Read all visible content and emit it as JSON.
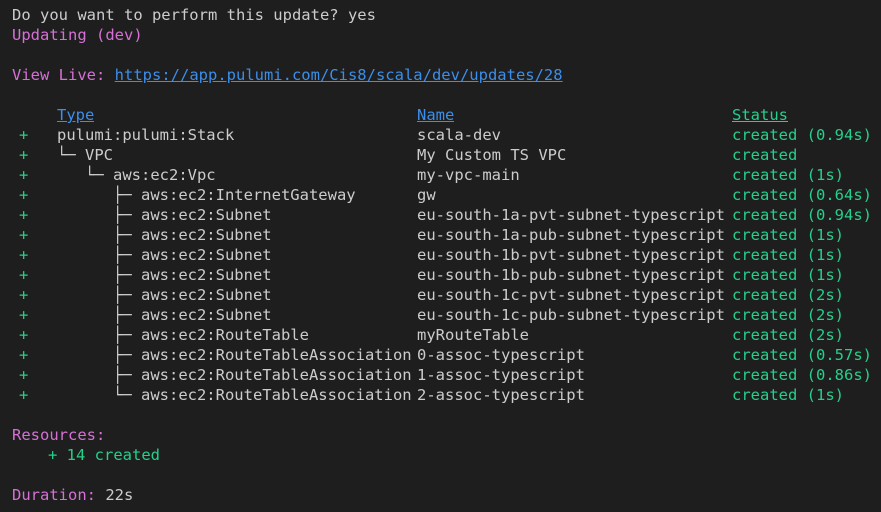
{
  "prompt": {
    "question": "Do you want to perform this update?",
    "answer": "yes"
  },
  "updating_label": "Updating (dev)",
  "view_live": {
    "label": "View Live:",
    "url": "https://app.pulumi.com/Cis8/scala/dev/updates/28"
  },
  "table": {
    "headers": {
      "type": "Type",
      "name": "Name",
      "status": "Status"
    },
    "rows": [
      {
        "op": "+",
        "type": "pulumi:pulumi:Stack",
        "name": "scala-dev",
        "status": "created (0.94s)"
      },
      {
        "op": "+",
        "type": "└─ VPC",
        "name": "My Custom TS VPC",
        "status": "created"
      },
      {
        "op": "+",
        "type": "   └─ aws:ec2:Vpc",
        "name": "my-vpc-main",
        "status": "created (1s)"
      },
      {
        "op": "+",
        "type": "      ├─ aws:ec2:InternetGateway",
        "name": "gw",
        "status": "created (0.64s)"
      },
      {
        "op": "+",
        "type": "      ├─ aws:ec2:Subnet",
        "name": "eu-south-1a-pvt-subnet-typescript",
        "status": "created (0.94s)"
      },
      {
        "op": "+",
        "type": "      ├─ aws:ec2:Subnet",
        "name": "eu-south-1a-pub-subnet-typescript",
        "status": "created (1s)"
      },
      {
        "op": "+",
        "type": "      ├─ aws:ec2:Subnet",
        "name": "eu-south-1b-pvt-subnet-typescript",
        "status": "created (1s)"
      },
      {
        "op": "+",
        "type": "      ├─ aws:ec2:Subnet",
        "name": "eu-south-1b-pub-subnet-typescript",
        "status": "created (1s)"
      },
      {
        "op": "+",
        "type": "      ├─ aws:ec2:Subnet",
        "name": "eu-south-1c-pvt-subnet-typescript",
        "status": "created (2s)"
      },
      {
        "op": "+",
        "type": "      ├─ aws:ec2:Subnet",
        "name": "eu-south-1c-pub-subnet-typescript",
        "status": "created (2s)"
      },
      {
        "op": "+",
        "type": "      ├─ aws:ec2:RouteTable",
        "name": "myRouteTable",
        "status": "created (2s)"
      },
      {
        "op": "+",
        "type": "      ├─ aws:ec2:RouteTableAssociation",
        "name": "0-assoc-typescript",
        "status": "created (0.57s)"
      },
      {
        "op": "+",
        "type": "      ├─ aws:ec2:RouteTableAssociation",
        "name": "1-assoc-typescript",
        "status": "created (0.86s)"
      },
      {
        "op": "+",
        "type": "      └─ aws:ec2:RouteTableAssociation",
        "name": "2-assoc-typescript",
        "status": "created (1s)"
      }
    ]
  },
  "resources": {
    "label": "Resources:",
    "summary": "+ 14 created"
  },
  "duration": {
    "label": "Duration:",
    "value": "22s"
  },
  "colors": {
    "background": "#1e1e1e",
    "text": "#cccccc",
    "magenta": "#d670d6",
    "link": "#3b8eea",
    "green": "#23d18b"
  }
}
